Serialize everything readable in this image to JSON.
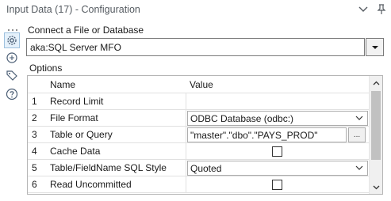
{
  "window": {
    "title": "Input Data (17) - Configuration"
  },
  "connect": {
    "label": "Connect a File or Database",
    "value": "aka:SQL Server MFO"
  },
  "options": {
    "label": "Options",
    "columns": {
      "name": "Name",
      "value": "Value"
    },
    "rows": [
      {
        "num": "1",
        "name": "Record Limit",
        "value": ""
      },
      {
        "num": "2",
        "name": "File Format",
        "value": "ODBC Database (odbc:)"
      },
      {
        "num": "3",
        "name": "Table or Query",
        "value": "\"master\".\"dbo\".\"PAYS_PROD\"",
        "button": "..."
      },
      {
        "num": "4",
        "name": "Cache Data",
        "checked": false
      },
      {
        "num": "5",
        "name": "Table/FieldName SQL Style",
        "value": "Quoted"
      },
      {
        "num": "6",
        "name": "Read Uncommitted",
        "checked": false
      }
    ]
  },
  "icons": {
    "titlebar": [
      "chevron-down-icon",
      "pin-icon"
    ],
    "rail": [
      "drag-handle-icon",
      "gear-icon",
      "annotation-icon",
      "tag-icon",
      "help-icon"
    ]
  },
  "colors": {
    "title_text": "#555b61",
    "rail_active_bg": "#e5f1fb",
    "rail_active_border": "#9ec1de",
    "grid_border": "#b5b5b5",
    "scroll_thumb": "#c1c1c1"
  }
}
